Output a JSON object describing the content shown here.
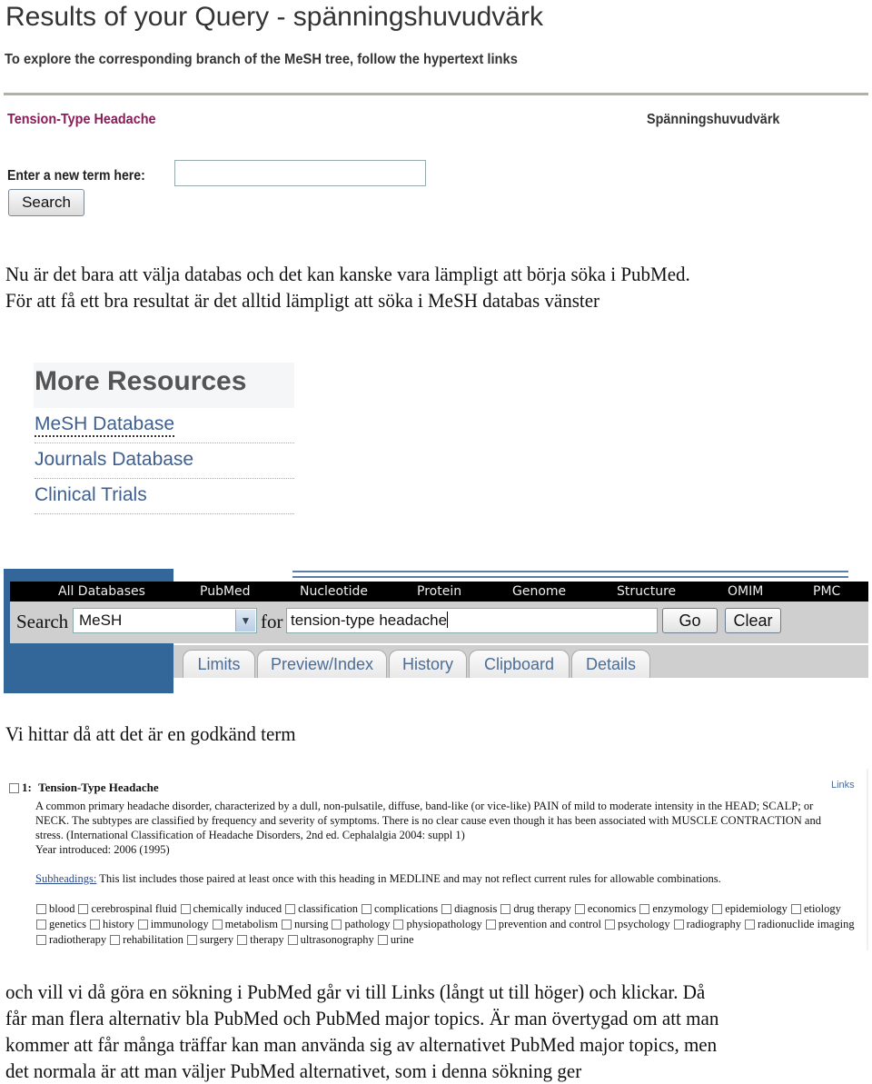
{
  "query_results": {
    "title": "Results of your Query - spänningshuvudvärk",
    "subtitle": "To explore the corresponding branch of the MeSH tree, follow the hypertext links",
    "term_english": "Tension-Type Headache",
    "term_swedish": "Spänningshuvudvärk",
    "new_term_label": "Enter a new term here:",
    "new_term_value": "",
    "search_button": "Search"
  },
  "prose1": [
    "Nu är det bara att välja databas och det kan kanske vara lämpligt att börja söka i PubMed.",
    "För att få ett bra resultat är det alltid lämpligt att söka i MeSH databas  vänster"
  ],
  "more_resources": {
    "heading": "More Resources",
    "links": [
      "MeSH Database",
      "Journals Database",
      "Clinical Trials"
    ]
  },
  "ncbi": {
    "nav": [
      "All Databases",
      "PubMed",
      "Nucleotide",
      "Protein",
      "Genome",
      "Structure",
      "OMIM",
      "PMC"
    ],
    "search_label": "Search",
    "database_selected": "MeSH",
    "for_label": "for",
    "query_value": "tension-type headache",
    "go_button": "Go",
    "clear_button": "Clear",
    "tabs": [
      "Limits",
      "Preview/Index",
      "History",
      "Clipboard",
      "Details"
    ]
  },
  "prose2": "Vi hittar då att det är en godkänd term",
  "mesh_record": {
    "number": "1:",
    "title": "Tension-Type Headache",
    "links_label": "Links",
    "description_lines": [
      "A common primary headache disorder, characterized by a dull, non-pulsatile, diffuse, band-like (or vice-like) PAIN of mild to moderate intensity in the HEAD; SCALP; or",
      "NECK. The subtypes are classified by frequency and severity of symptoms. There is no clear cause even though it has been associated with MUSCLE CONTRACTION and",
      "stress. (International Classification of Headache Disorders, 2nd ed. Cephalalgia 2004: suppl 1)",
      "Year introduced: 2006 (1995)"
    ],
    "subheadings_link": "Subheadings:",
    "subheadings_note": " This list includes those paired at least once with this heading in MEDLINE and may not reflect current rules for allowable combinations.",
    "subheading_rows": [
      [
        "blood",
        "cerebrospinal fluid",
        "chemically induced",
        "classification",
        "complications",
        "diagnosis",
        "drug therapy",
        "economics",
        "enzymology",
        "epidemiology",
        "etiology"
      ],
      [
        "genetics",
        "history",
        "immunology",
        "metabolism",
        "nursing",
        "pathology",
        "physiopathology",
        "prevention and control",
        "psychology",
        "radiography",
        "radionuclide imaging"
      ],
      [
        "radiotherapy",
        "rehabilitation",
        "surgery",
        "therapy",
        "ultrasonography",
        "urine"
      ]
    ]
  },
  "prose3": [
    "och vill vi då göra en sökning i PubMed går vi till Links (långt ut till höger) och klickar. Då",
    "får man flera alternativ bla PubMed  och PubMed major topics. Är man övertygad om att man",
    "kommer att får många träffar kan man använda sig av alternativet PubMed major topics, men",
    "det normala är att man väljer PubMed alternativet, som i denna sökning ger"
  ]
}
